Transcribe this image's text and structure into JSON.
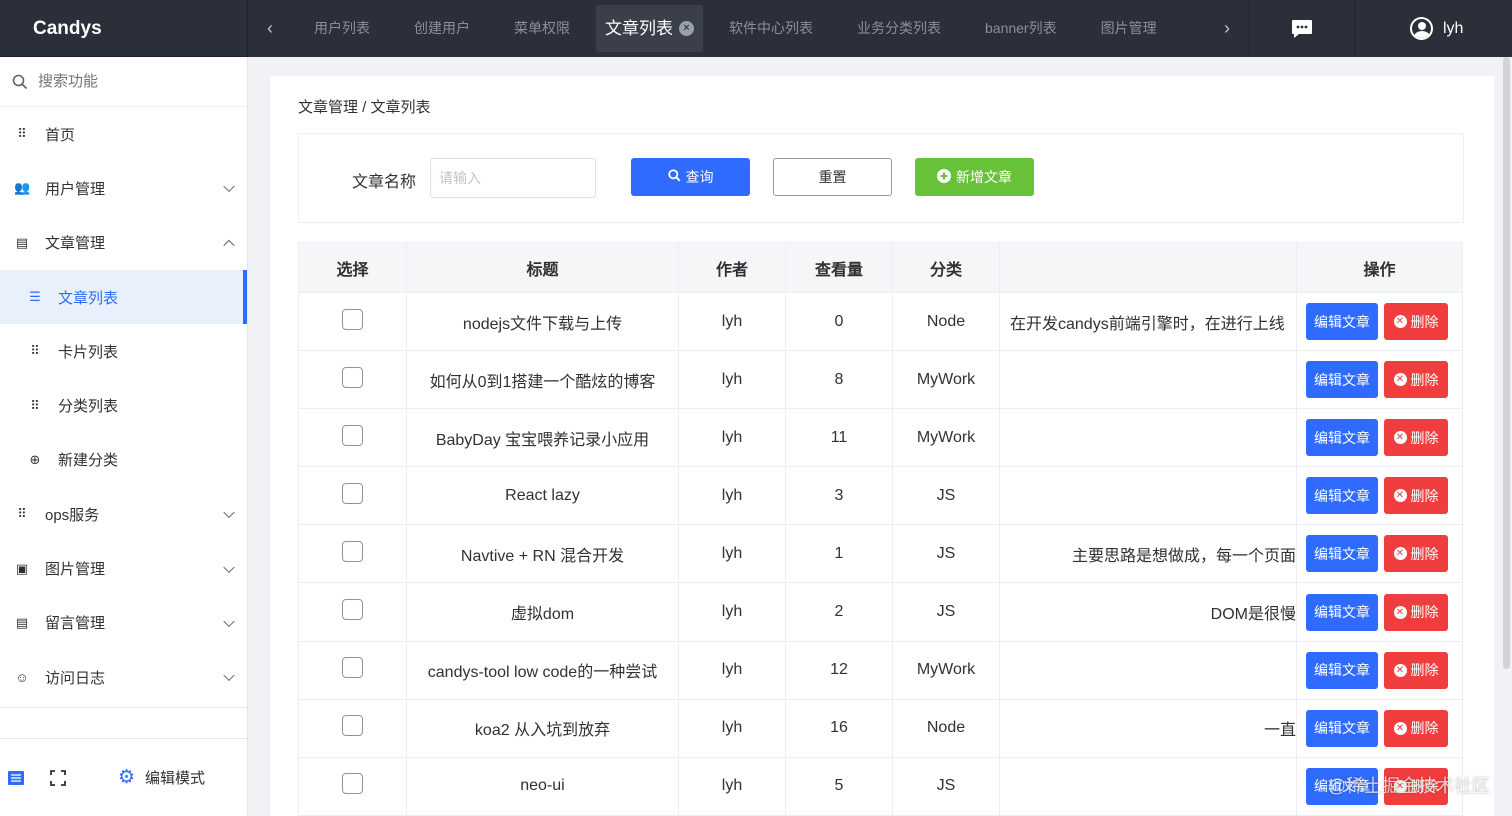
{
  "app": {
    "title": "Candys"
  },
  "tabs": {
    "items": [
      "用户列表",
      "创建用户",
      "菜单权限",
      "文章列表",
      "软件中心列表",
      "业务分类列表",
      "banner列表",
      "图片管理"
    ],
    "active_index": 3,
    "close_glyph": "×"
  },
  "user": {
    "name": "lyh"
  },
  "sidebar": {
    "search_placeholder": "搜索功能",
    "items": [
      {
        "label": "首页",
        "icon": "grid-icon"
      },
      {
        "label": "用户管理",
        "icon": "users-icon"
      },
      {
        "label": "文章管理",
        "icon": "document-icon"
      },
      {
        "label": "文章列表",
        "icon": "list-icon"
      },
      {
        "label": "卡片列表",
        "icon": "grid-icon"
      },
      {
        "label": "分类列表",
        "icon": "grid-icon"
      },
      {
        "label": "新建分类",
        "icon": "plus-circle-icon"
      },
      {
        "label": "ops服务",
        "icon": "grid-icon"
      },
      {
        "label": "图片管理",
        "icon": "image-icon"
      },
      {
        "label": "留言管理",
        "icon": "document-icon"
      },
      {
        "label": "访问日志",
        "icon": "smile-icon"
      }
    ],
    "footer": {
      "edit_mode": "编辑模式"
    }
  },
  "breadcrumb": "文章管理 / 文章列表",
  "filter": {
    "label": "文章名称",
    "placeholder": "请输入",
    "query": "查询",
    "reset": "重置",
    "add": "新增文章"
  },
  "table": {
    "headers": [
      "选择",
      "标题",
      "作者",
      "查看量",
      "分类",
      "",
      "操作"
    ],
    "edit_label": "编辑文章",
    "delete_label": "删除",
    "rows": [
      {
        "title": "nodejs文件下载与上传",
        "author": "lyh",
        "views": "0",
        "category": "Node",
        "content": "在开发candys前端引擎时，在进行上线"
      },
      {
        "title": "如何从0到1搭建一个酷炫的博客",
        "author": "lyh",
        "views": "8",
        "category": "MyWork",
        "content": ""
      },
      {
        "title": "BabyDay 宝宝喂养记录小应用",
        "author": "lyh",
        "views": "11",
        "category": "MyWork",
        "content": ""
      },
      {
        "title": "React lazy",
        "author": "lyh",
        "views": "3",
        "category": "JS",
        "content": ""
      },
      {
        "title": "Navtive + RN 混合开发",
        "author": "lyh",
        "views": "1",
        "category": "JS",
        "content": "主要思路是想做成，每一个页面"
      },
      {
        "title": "虚拟dom",
        "author": "lyh",
        "views": "2",
        "category": "JS",
        "content": "DOM是很慢"
      },
      {
        "title": "candys-tool low code的一种尝试",
        "author": "lyh",
        "views": "12",
        "category": "MyWork",
        "content": ""
      },
      {
        "title": "koa2 从入坑到放弃",
        "author": "lyh",
        "views": "16",
        "category": "Node",
        "content": "一直"
      },
      {
        "title": "neo-ui",
        "author": "lyh",
        "views": "5",
        "category": "JS",
        "content": ""
      }
    ]
  },
  "watermark": "@稀土掘金技术社区"
}
